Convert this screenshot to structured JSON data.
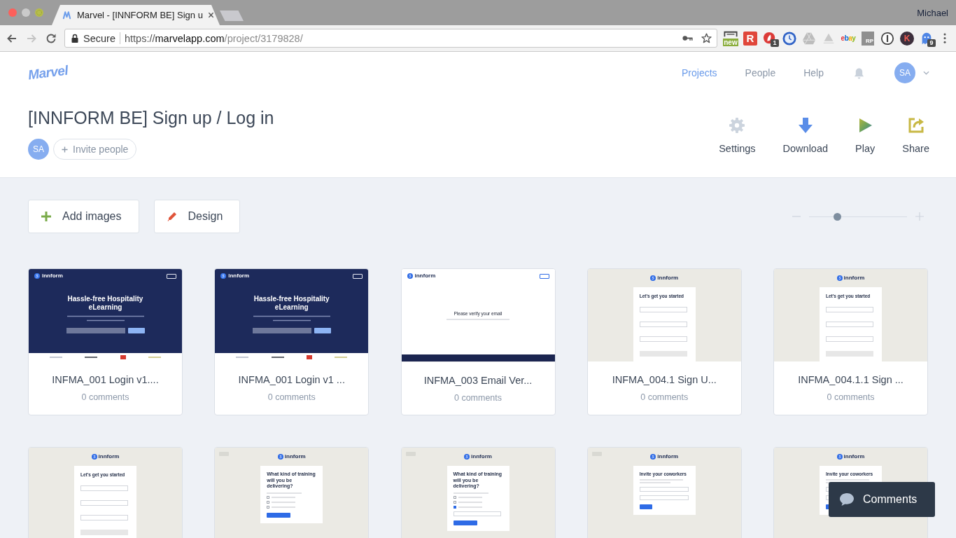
{
  "browser": {
    "tab_title": "Marvel - [INNFORM BE] Sign u",
    "profile": "Michael",
    "nav_buttons": [
      {
        "kind": "back",
        "disabled": false
      },
      {
        "kind": "forward",
        "disabled": true
      },
      {
        "kind": "reload",
        "disabled": false
      }
    ],
    "address": {
      "security": "Secure",
      "scheme": "https://",
      "host": "marvelapp.com",
      "path": "/project/3179828/"
    },
    "extensions": [
      {
        "kind": "new",
        "label": "new"
      },
      {
        "kind": "square-letter",
        "label": "R"
      },
      {
        "kind": "rocket",
        "badge": "1"
      },
      {
        "kind": "clock"
      },
      {
        "kind": "drive"
      },
      {
        "kind": "triangle"
      },
      {
        "kind": "wordmark",
        "label": "ebay"
      },
      {
        "kind": "tile-letters",
        "label": "RP"
      },
      {
        "kind": "password"
      },
      {
        "kind": "circle-letter",
        "label": "K"
      },
      {
        "kind": "ghost",
        "badge": "9"
      }
    ]
  },
  "app": {
    "logo": "Marvel",
    "nav": [
      {
        "label": "Projects",
        "selected": true
      },
      {
        "label": "People",
        "selected": false
      },
      {
        "label": "Help",
        "selected": false
      }
    ],
    "user_initials": "SA"
  },
  "project": {
    "title": "[INNFORM BE] Sign up / Log in",
    "members": [
      "SA"
    ],
    "invite": "Invite people",
    "actions": [
      {
        "kind": "settings",
        "label": "Settings"
      },
      {
        "kind": "download",
        "label": "Download"
      },
      {
        "kind": "play",
        "label": "Play"
      },
      {
        "kind": "share",
        "label": "Share"
      }
    ]
  },
  "toolbar": {
    "buttons": [
      {
        "kind": "add",
        "label": "Add images"
      },
      {
        "kind": "design",
        "label": "Design"
      }
    ],
    "zoom": {
      "level": 0.29
    }
  },
  "screens": [
    {
      "name": "INFMA_001 Login v1....",
      "comments": "0 comments",
      "preview": {
        "kind": "landing",
        "logo": "innform",
        "heading": "Hassle-free Hospitality eLearning"
      }
    },
    {
      "name": "INFMA_001 Login v1 ...",
      "comments": "0 comments",
      "preview": {
        "kind": "landing",
        "logo": "innform",
        "heading": "Hassle-free Hospitality eLearning"
      }
    },
    {
      "name": "INFMA_003 Email Ver...",
      "comments": "0 comments",
      "preview": {
        "kind": "verify",
        "logo": "innform",
        "heading": "Please verify your email"
      }
    },
    {
      "name": "INFMA_004.1 Sign U...",
      "comments": "0 comments",
      "preview": {
        "kind": "signup",
        "logo": "innform",
        "heading": "Let's get you started"
      }
    },
    {
      "name": "INFMA_004.1.1 Sign ...",
      "comments": "0 comments",
      "preview": {
        "kind": "signup",
        "logo": "innform",
        "heading": "Let's get you started"
      }
    },
    {
      "preview": {
        "kind": "signup",
        "logo": "innform",
        "heading": "Let's get you started"
      }
    },
    {
      "preview": {
        "kind": "training",
        "logo": "innform",
        "back": true,
        "heading": "What kind of training will you be delivering?",
        "options": [
          {
            "checked": false
          },
          {
            "checked": false
          },
          {
            "checked": false
          }
        ],
        "other_field": false
      }
    },
    {
      "preview": {
        "kind": "training",
        "logo": "innform",
        "back": true,
        "heading": "What kind of training will you be delivering?",
        "options": [
          {
            "checked": false
          },
          {
            "checked": false
          },
          {
            "checked": true
          }
        ],
        "other_field": true
      }
    },
    {
      "preview": {
        "kind": "invite",
        "logo": "innform",
        "back": true,
        "heading": "Invite your coworkers"
      }
    },
    {
      "preview": {
        "kind": "invite",
        "logo": "innform",
        "back": false,
        "heading": "Invite your coworkers"
      }
    }
  ],
  "comments_button": "Comments"
}
